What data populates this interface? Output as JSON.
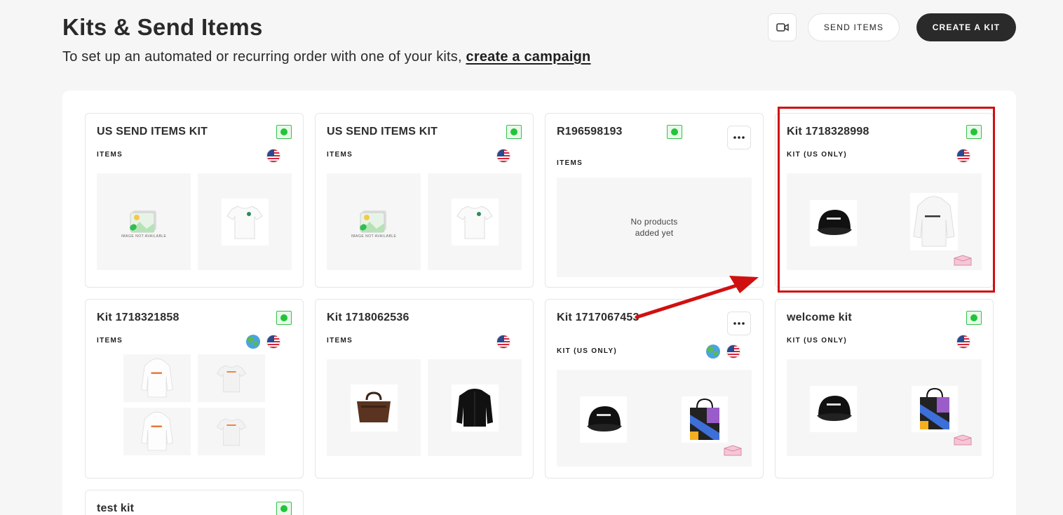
{
  "header": {
    "title": "Kits & Send Items",
    "subtitle_text": "To set up an automated or recurring order with one of your kits, ",
    "subtitle_link": "create a campaign",
    "send_items_label": "SEND ITEMS",
    "create_kit_label": "CREATE A KIT"
  },
  "cards": [
    {
      "title": "US SEND ITEMS KIT",
      "subtitle": "ITEMS",
      "image_na": "IMAGE NOT AVAILABLE"
    },
    {
      "title": "US SEND ITEMS KIT",
      "subtitle": "ITEMS",
      "image_na": "IMAGE NOT AVAILABLE"
    },
    {
      "title": "R196598193",
      "subtitle": "ITEMS",
      "empty_line1": "No products",
      "empty_line2": "added yet"
    },
    {
      "title": "Kit 1718328998",
      "subtitle": "KIT (US ONLY)"
    },
    {
      "title": "Kit 1718321858",
      "subtitle": "ITEMS"
    },
    {
      "title": "Kit 1718062536",
      "subtitle": "ITEMS"
    },
    {
      "title": "Kit 1717067453",
      "subtitle": "KIT (US ONLY)"
    },
    {
      "title": "welcome kit",
      "subtitle": "KIT (US ONLY)"
    },
    {
      "title": "test kit",
      "subtitle": ""
    }
  ],
  "colors": {
    "accent_dark": "#2a2a2a",
    "status_green": "#22c43a",
    "highlight_red": "#d01010"
  },
  "icons": [
    "video-camera-icon",
    "status-active-icon",
    "us-flag-icon",
    "globe-icon",
    "more-options-icon",
    "box-icon"
  ]
}
